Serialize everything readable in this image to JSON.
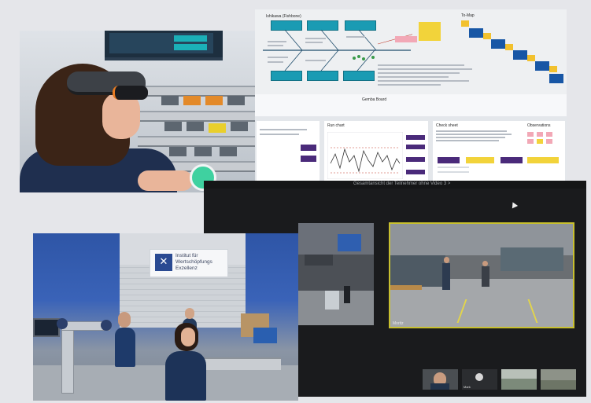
{
  "whiteboard": {
    "fishbone_title": "Ishikawa (Fishbone)",
    "to_map_title": "To-Map",
    "section_title": "Gemba Board",
    "chart_title": "Run chart",
    "check_sheet_title": "Check sheet",
    "observations_title": "Observations"
  },
  "video_call": {
    "header": "Gesamtansicht der Teilnehmer ohne Video 3 >",
    "main_tile_label": "Moritz",
    "left_tile_label": "",
    "thumbnails": [
      {
        "label": ""
      },
      {
        "label": "Mark"
      },
      {
        "label": ""
      },
      {
        "label": ""
      }
    ]
  },
  "institute_sign": {
    "line1": "Institut für",
    "line2": "Wertschöpfungs",
    "line3": "Exzellenz",
    "logo_glyph": "✕"
  },
  "colors": {
    "background": "#e5e6ea",
    "teal": "#1a9bb3",
    "sticky_yellow": "#f2c12e",
    "board_blue": "#1756a5",
    "active_speaker_border": "#c8c02f"
  }
}
